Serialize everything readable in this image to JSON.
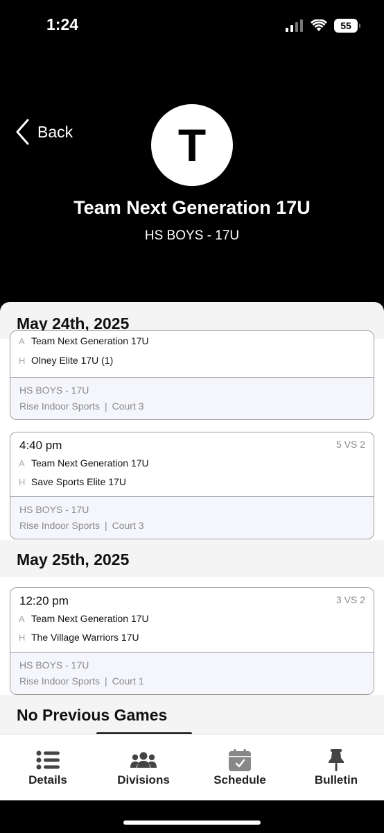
{
  "status_bar": {
    "time": "1:24",
    "battery": "55",
    "icons": [
      "signal-icon",
      "wifi-icon",
      "battery-icon"
    ]
  },
  "header": {
    "back_label": "Back",
    "avatar_letter": "T",
    "team_name": "Team Next Generation 17U",
    "division": "HS BOYS - 17U"
  },
  "schedule": {
    "sections": [
      {
        "date": "May 24th, 2025",
        "games": [
          {
            "time": "",
            "score": "",
            "away_letter": "A",
            "away_team": "Team Next Generation 17U",
            "home_letter": "H",
            "home_team": "Olney Elite 17U (1)",
            "division": "HS BOYS - 17U",
            "venue": "Rise Indoor Sports",
            "court": "Court 3"
          },
          {
            "time": "4:40 pm",
            "score": "5 VS 2",
            "away_letter": "A",
            "away_team": "Team Next Generation 17U",
            "home_letter": "H",
            "home_team": "Save Sports Elite 17U",
            "division": "HS BOYS - 17U",
            "venue": "Rise Indoor Sports",
            "court": "Court 3"
          }
        ]
      },
      {
        "date": "May 25th, 2025",
        "games": [
          {
            "time": "12:20 pm",
            "score": "3 VS 2",
            "away_letter": "A",
            "away_team": "Team Next Generation 17U",
            "home_letter": "H",
            "home_team": "The Village Warriors 17U",
            "division": "HS BOYS - 17U",
            "venue": "Rise Indoor Sports",
            "court": "Court 1"
          }
        ]
      }
    ],
    "separator": "|",
    "no_previous": "No Previous Games"
  },
  "tab_bar": {
    "tabs": [
      {
        "label": "Details",
        "icon": "list-icon"
      },
      {
        "label": "Divisions",
        "icon": "group-icon"
      },
      {
        "label": "Schedule",
        "icon": "calendar-check-icon"
      },
      {
        "label": "Bulletin",
        "icon": "pushpin-icon"
      }
    ]
  }
}
